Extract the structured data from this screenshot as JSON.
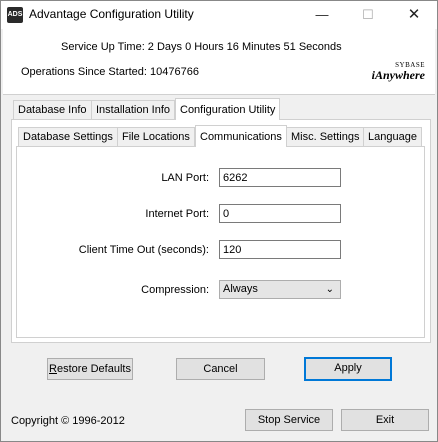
{
  "window": {
    "app_icon_text": "ADS",
    "title": "Advantage Configuration Utility",
    "minimize_glyph": "—",
    "maximize_glyph": "☐",
    "close_glyph": "✕"
  },
  "header": {
    "uptime": "Service Up Time: 2 Days 0 Hours 16 Minutes 51 Seconds",
    "operations": "Operations Since Started: 10476766",
    "logo_small": "SYBASE",
    "logo_big": "iAnywhere"
  },
  "top_tabs": [
    {
      "label": "Database Info"
    },
    {
      "label": "Installation Info"
    },
    {
      "label": "Configuration Utility"
    }
  ],
  "sub_tabs": [
    {
      "label": "Database Settings"
    },
    {
      "label": "File Locations"
    },
    {
      "label": "Communications"
    },
    {
      "label": "Misc. Settings"
    },
    {
      "label": "Language"
    }
  ],
  "form": {
    "lan_port_label": "LAN Port:",
    "lan_port_value": "6262",
    "internet_port_label": "Internet Port:",
    "internet_port_value": "0",
    "timeout_label": "Client Time Out (seconds):",
    "timeout_value": "120",
    "compression_label": "Compression:",
    "compression_value": "Always"
  },
  "buttons": {
    "restore_pre": "",
    "restore_mnemonic": "R",
    "restore_post": "estore Defaults",
    "cancel": "Cancel",
    "apply": "Apply",
    "stop": "Stop Service",
    "exit": "Exit"
  },
  "footer": {
    "copyright": "Copyright © 1996-2012"
  }
}
